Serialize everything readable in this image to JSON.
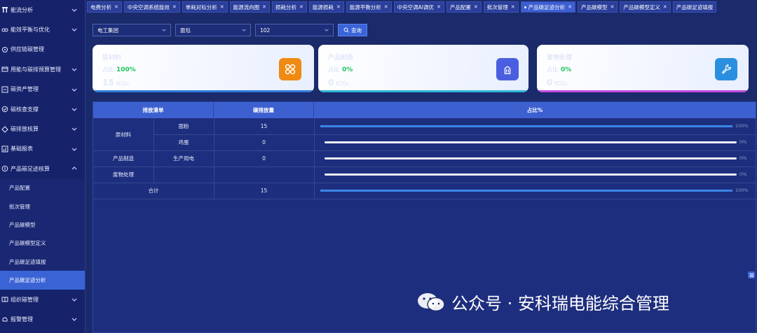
{
  "sidebar": {
    "items": [
      {
        "label": "能流分析",
        "icon": "flow-icon"
      },
      {
        "label": "能效平衡与优化",
        "icon": "balance-icon"
      },
      {
        "label": "供应链碳管理",
        "icon": "supply-chain-icon"
      },
      {
        "label": "用能与碳排预算管理",
        "icon": "budget-icon"
      },
      {
        "label": "碳资产管理",
        "icon": "asset-icon"
      },
      {
        "label": "碳核查支撑",
        "icon": "verify-icon"
      },
      {
        "label": "碳排放核算",
        "icon": "accounting-icon"
      },
      {
        "label": "基础报表",
        "icon": "report-icon"
      },
      {
        "label": "产品碳足迹核算",
        "icon": "footprint-icon"
      }
    ],
    "subitems": [
      {
        "label": "产品配置"
      },
      {
        "label": "批次管理"
      },
      {
        "label": "产品碳模型"
      },
      {
        "label": "产品碳模型定义"
      },
      {
        "label": "产品碳足迹填报"
      },
      {
        "label": "产品碳足迹分析"
      }
    ],
    "bottom_items": [
      {
        "label": "组织碳管理",
        "icon": "org-icon"
      },
      {
        "label": "报警管理",
        "icon": "alarm-icon"
      }
    ]
  },
  "tabs": [
    {
      "label": "电费分析"
    },
    {
      "label": "中央空调系统能效"
    },
    {
      "label": "单耗对标分析"
    },
    {
      "label": "能源流向图"
    },
    {
      "label": "损耗分析"
    },
    {
      "label": "能源损耗"
    },
    {
      "label": "能源平衡分析"
    },
    {
      "label": "中央空调AI调优"
    },
    {
      "label": "产品配置"
    },
    {
      "label": "批次管理"
    },
    {
      "label": "产品碳足迹分析"
    },
    {
      "label": "产品碳模型"
    },
    {
      "label": "产品碳模型定义"
    },
    {
      "label": "产品碳足迹填报"
    }
  ],
  "filters": {
    "company": "电工集团",
    "product": "面包",
    "batch": "102",
    "query_label": "查询"
  },
  "cards": [
    {
      "title": "原材料",
      "sub_label": "占比",
      "pct": "100%",
      "value": "15",
      "unit": "tCO₂",
      "icon": "grid-icon",
      "icon_color": "#ef8a12",
      "bar": "#2f7bdc"
    },
    {
      "title": "产品制造",
      "sub_label": "占比",
      "pct": "0%",
      "value": "0",
      "unit": "tCO₂",
      "icon": "factory-icon",
      "icon_color": "#4a5fe0",
      "bar": "#2fb5d9"
    },
    {
      "title": "废物处理",
      "sub_label": "占比",
      "pct": "0%",
      "value": "0",
      "unit": "tCO₂",
      "icon": "wrench-icon",
      "icon_color": "#2b8fe0",
      "bar": "#c44be0"
    }
  ],
  "table": {
    "headers": {
      "category": "排放清单",
      "amount": "碳排放量",
      "ratio": "占比%"
    },
    "rows": [
      {
        "group": "原材料",
        "item": "面粉",
        "amount": "15",
        "ratio": 100,
        "ratio_label": "100%"
      },
      {
        "group": "",
        "item": "鸡蛋",
        "amount": "0",
        "ratio": 0,
        "ratio_label": "0%"
      },
      {
        "group": "产品制造",
        "item": "生产用电",
        "amount": "0",
        "ratio": 0,
        "ratio_label": "0%"
      },
      {
        "group": "废物处理",
        "item": "",
        "amount": "",
        "ratio": 0,
        "ratio_label": "0%"
      },
      {
        "group": "合计",
        "item": "",
        "amount": "15",
        "ratio": 100,
        "ratio_label": "100%"
      }
    ]
  },
  "watermark": {
    "text": "公众号 · 安科瑞电能综合管理"
  }
}
